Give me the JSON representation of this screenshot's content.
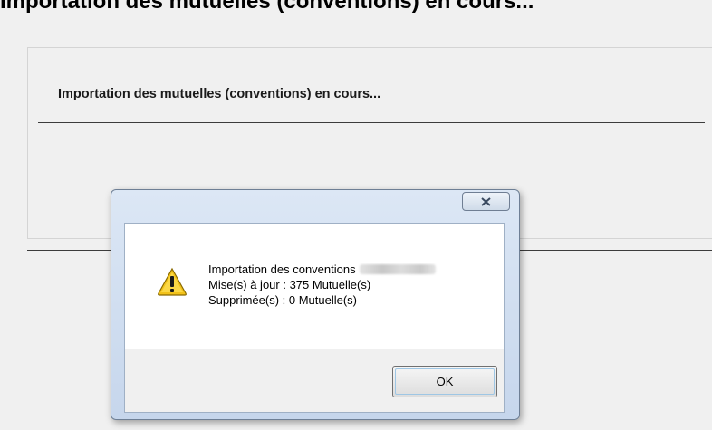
{
  "background": {
    "top_strip_text": "Importation des mutuelles (conventions) en cours...",
    "title": "Importation des mutuelles (conventions) en cours..."
  },
  "dialog": {
    "message_lines": [
      "Importation des conventions",
      "Mise(s) à jour : 375 Mutuelle(s)",
      "Supprimée(s) : 0 Mutuelle(s)"
    ],
    "ok_label": "OK",
    "icons": {
      "close": "close-icon",
      "warning": "warning-icon"
    }
  },
  "colors": {
    "window_bg": "#f0f0f0",
    "dialog_frame": "#c6d6ec",
    "warning_yellow": "#f2c21a"
  }
}
